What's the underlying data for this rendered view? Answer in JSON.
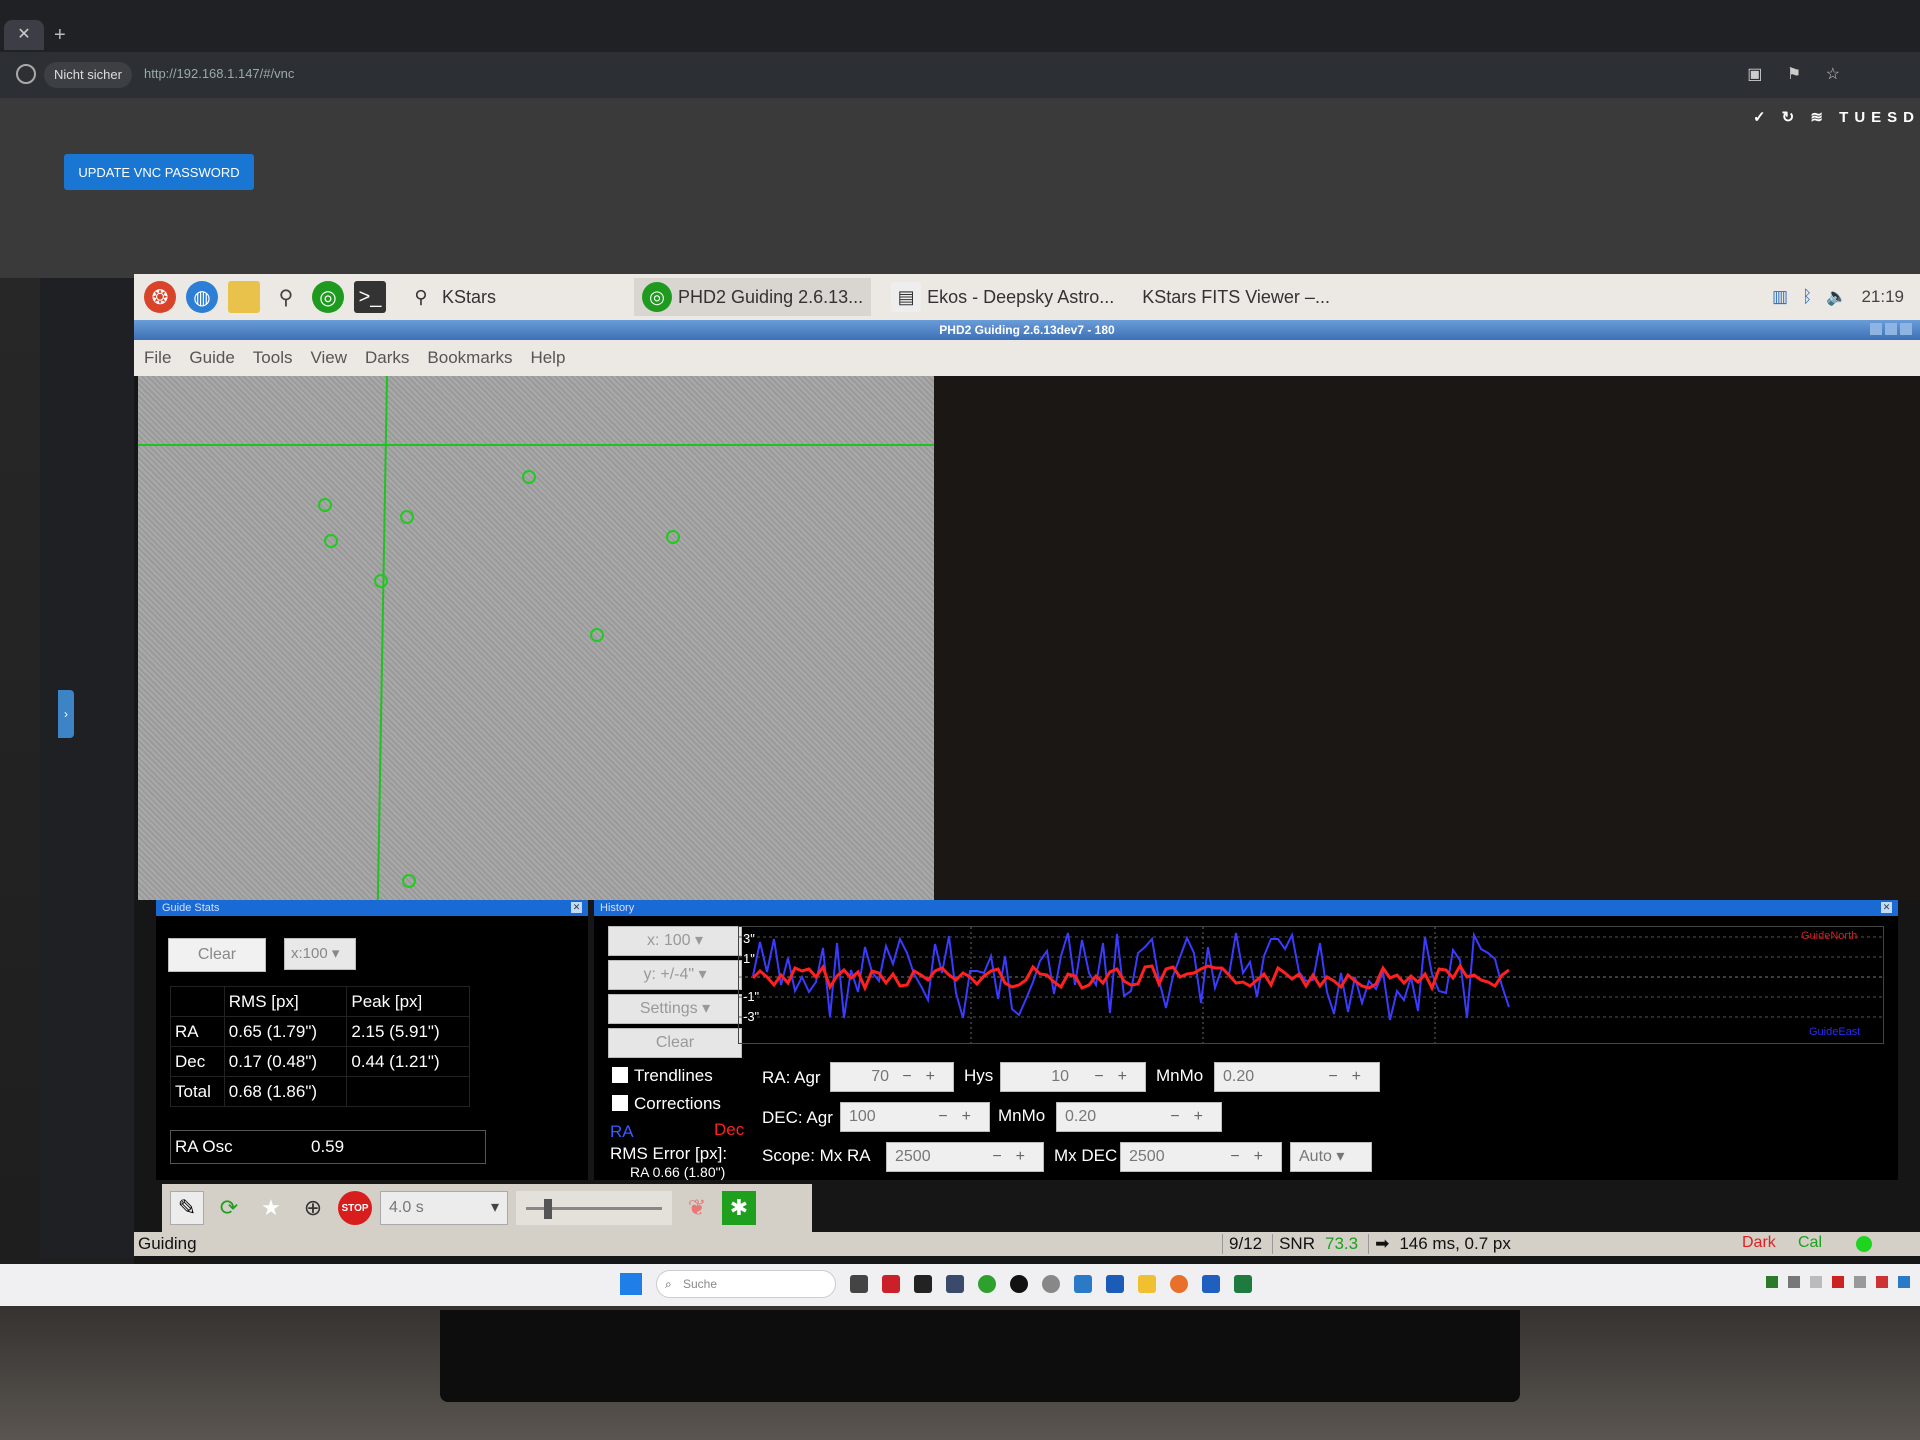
{
  "browser": {
    "security_label": "Nicht sicher",
    "url": "http://192.168.1.147/#/vnc",
    "vnc_button": "UPDATE VNC PASSWORD",
    "system_day": "TUESD"
  },
  "panel": {
    "tasks": [
      "KStars",
      "PHD2 Guiding 2.6.13...",
      "Ekos - Deepsky Astro...",
      "KStars FITS Viewer –..."
    ],
    "clock": "21:19"
  },
  "window": {
    "title": "PHD2 Guiding 2.6.13dev7 - 180",
    "menu": [
      "File",
      "Guide",
      "Tools",
      "View",
      "Darks",
      "Bookmarks",
      "Help"
    ]
  },
  "guide_stats": {
    "title": "Guide Stats",
    "clear_label": "Clear",
    "scale": "x:100",
    "headers": [
      "",
      "RMS [px]",
      "Peak [px]"
    ],
    "rows": [
      [
        "RA",
        "0.65 (1.79\")",
        "2.15 (5.91\")"
      ],
      [
        "Dec",
        "0.17 (0.48\")",
        "0.44 (1.21\")"
      ],
      [
        "Total",
        "0.68 (1.86\")",
        ""
      ]
    ],
    "ra_osc_label": "RA Osc",
    "ra_osc_value": "0.59"
  },
  "history": {
    "title": "History",
    "x_scale": "x: 100",
    "y_scale": "y: +/-4\"",
    "settings_label": "Settings",
    "clear_label": "Clear",
    "trendlines_label": "Trendlines",
    "corrections_label": "Corrections",
    "ra_label": "RA",
    "dec_label": "Dec",
    "rms_label": "RMS Error [px]:",
    "rms_value": "RA 0.66 (1.80\")",
    "y_ticks": [
      "3\"",
      "1\"",
      "-1\"",
      "-3\""
    ],
    "north_label": "GuideNorth",
    "east_label": "GuideEast",
    "ra_color": "#3b3bff",
    "dec_color": "#ff2020"
  },
  "params": {
    "ra_agr_label": "RA: Agr",
    "ra_agr": "70",
    "hys_label": "Hys",
    "hys": "10",
    "ra_mnmo_label": "MnMo",
    "ra_mnmo": "0.20",
    "dec_agr_label": "DEC: Agr",
    "dec_agr": "100",
    "dec_mnmo_label": "MnMo",
    "dec_mnmo": "0.20",
    "mx_ra_label": "Scope: Mx RA",
    "mx_ra": "2500",
    "mx_dec_label": "Mx DEC",
    "mx_dec": "2500",
    "mode": "Auto"
  },
  "toolbar": {
    "exposure": "4.0 s",
    "stop_label": "STOP"
  },
  "status": {
    "state": "Guiding",
    "frames": "9/12",
    "snr_label": "SNR",
    "snr": "73.3",
    "pulse": "146 ms, 0.7 px",
    "dark": "Dark",
    "cal": "Cal"
  },
  "taskbar": {
    "search": "Suche"
  }
}
